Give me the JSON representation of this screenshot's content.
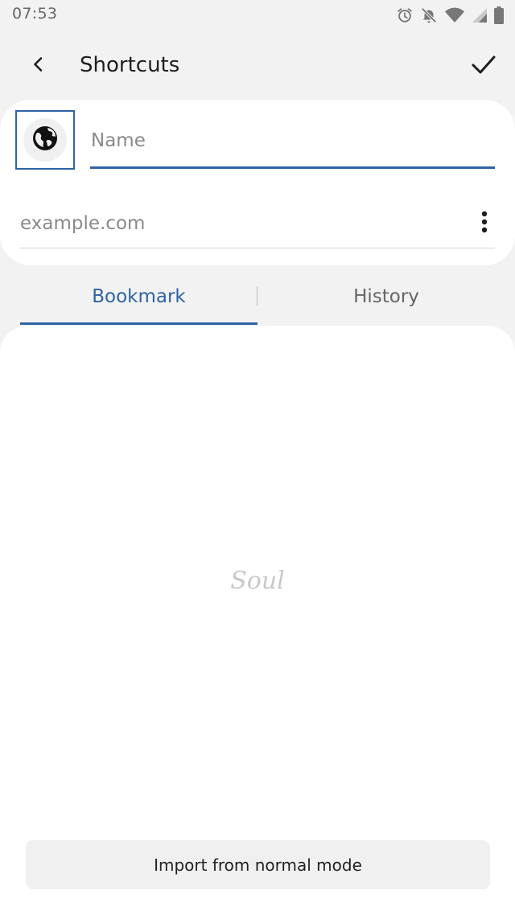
{
  "status_bar": {
    "time": "07:53",
    "icons": [
      "alarm-icon",
      "notifications-off-icon",
      "wifi-icon",
      "signal-icon",
      "battery-icon"
    ]
  },
  "toolbar": {
    "title": "Shortcuts",
    "back_icon": "chevron-left-icon",
    "confirm_icon": "check-icon"
  },
  "form": {
    "favicon_icon": "globe-icon",
    "name_placeholder": "Name",
    "name_value": "",
    "url_placeholder": "example.com",
    "url_value": "",
    "more_icon": "more-vertical-icon"
  },
  "tabs": [
    {
      "label": "Bookmark",
      "selected": true
    },
    {
      "label": "History",
      "selected": false
    }
  ],
  "content": {
    "watermark": "Soul",
    "import_label": "Import from normal mode"
  },
  "colors": {
    "accent": "#2f63a3",
    "background": "#f2f2f2",
    "card": "#ffffff",
    "button": "#f0f0f0"
  }
}
